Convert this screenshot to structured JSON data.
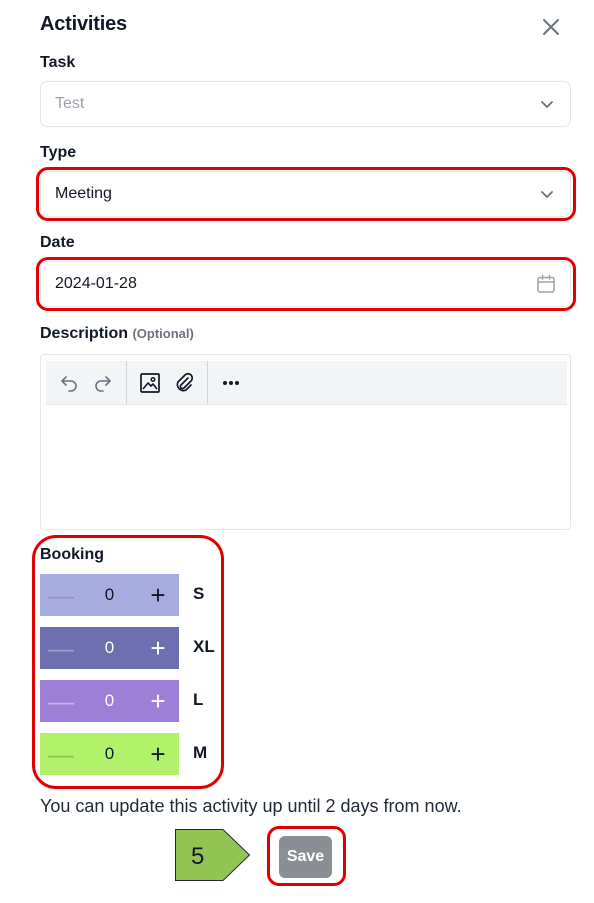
{
  "panel": {
    "title": "Activities"
  },
  "task": {
    "label": "Task",
    "value": "Test"
  },
  "type": {
    "label": "Type",
    "value": "Meeting"
  },
  "date": {
    "label": "Date",
    "value": "2024-01-28"
  },
  "description": {
    "label": "Description",
    "optional": "(Optional)"
  },
  "booking": {
    "label": "Booking",
    "items": [
      {
        "size": "S",
        "count": "0",
        "color": "#a6acdd"
      },
      {
        "size": "XL",
        "count": "0",
        "color": "#6d6fb0"
      },
      {
        "size": "L",
        "count": "0",
        "color": "#9e7fd8"
      },
      {
        "size": "M",
        "count": "0",
        "color": "#b1f26a"
      }
    ]
  },
  "note": "You can update this activity up until 2 days from now.",
  "save_label": "Save",
  "step_marker": {
    "number": "5",
    "color": "#92c355"
  },
  "highlight_color": "#e00000"
}
